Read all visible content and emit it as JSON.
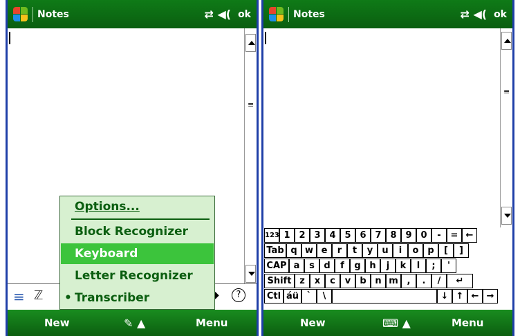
{
  "left": {
    "title": "Notes",
    "status_icons": "⇄ ◀(",
    "ok": "ok",
    "menu": {
      "options": "Options...",
      "block": "Block Recognizer",
      "keyboard": "Keyboard",
      "letter": "Letter Recognizer",
      "transcriber": "Transcriber"
    },
    "softkeys": {
      "left": "New",
      "right": "Menu"
    },
    "input_icons": {
      "list": "≡",
      "zz": "ℤ",
      "back": "◆",
      "help": "?"
    }
  },
  "right": {
    "title": "Notes",
    "status_icons": "⇄ ◀(",
    "ok": "ok",
    "softkeys": {
      "left": "New",
      "right": "Menu"
    }
  },
  "keyboard": {
    "row1": [
      "123",
      "1",
      "2",
      "3",
      "4",
      "5",
      "6",
      "7",
      "8",
      "9",
      "0",
      "-",
      "=",
      "←"
    ],
    "row2": [
      "Tab",
      "q",
      "w",
      "e",
      "r",
      "t",
      "y",
      "u",
      "i",
      "o",
      "p",
      "[",
      "]"
    ],
    "row3": [
      "CAP",
      "a",
      "s",
      "d",
      "f",
      "g",
      "h",
      "j",
      "k",
      "l",
      ";",
      "'"
    ],
    "row4": [
      "Shift",
      "z",
      "x",
      "c",
      "v",
      "b",
      "n",
      "m",
      ",",
      ".",
      "/",
      "↵"
    ],
    "row5": [
      "Ctl",
      "áü",
      "`",
      "\\",
      "",
      "↓",
      "↑",
      "←",
      "→"
    ]
  },
  "colors": {
    "green": "#0f7a17",
    "highlight": "#3cc43c",
    "menubg": "#d7f0d0",
    "frame": "#1f3fa8"
  }
}
